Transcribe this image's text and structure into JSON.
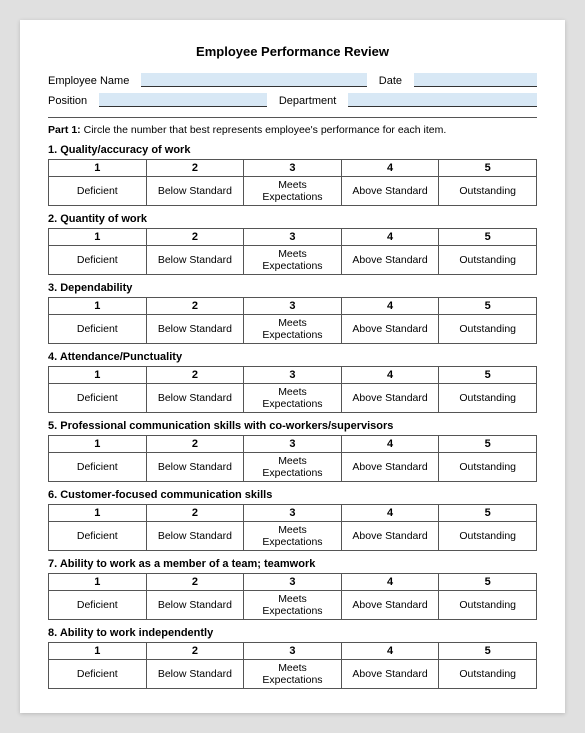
{
  "title": "Employee Performance Review",
  "fields": {
    "employee_name_label": "Employee Name",
    "date_label": "Date",
    "position_label": "Position",
    "department_label": "Department"
  },
  "part1": {
    "label": "Part 1:",
    "instruction": "Circle the number that best represents employee's performance for each item."
  },
  "categories": [
    {
      "id": "1",
      "title": "1. Quality/accuracy of work"
    },
    {
      "id": "2",
      "title": "2. Quantity of work"
    },
    {
      "id": "3",
      "title": "3. Dependability"
    },
    {
      "id": "4",
      "title": "4. Attendance/Punctuality"
    },
    {
      "id": "5",
      "title": "5. Professional communication skills with co-workers/supervisors"
    },
    {
      "id": "6",
      "title": "6. Customer-focused communication skills"
    },
    {
      "id": "7",
      "title": "7. Ability to work as a member of a team; teamwork"
    },
    {
      "id": "8",
      "title": "8. Ability to work independently"
    }
  ],
  "rating_numbers": [
    "1",
    "2",
    "3",
    "4",
    "5"
  ],
  "rating_labels": [
    "Deficient",
    "Below Standard",
    "Meets Expectations",
    "Above Standard",
    "Outstanding"
  ]
}
